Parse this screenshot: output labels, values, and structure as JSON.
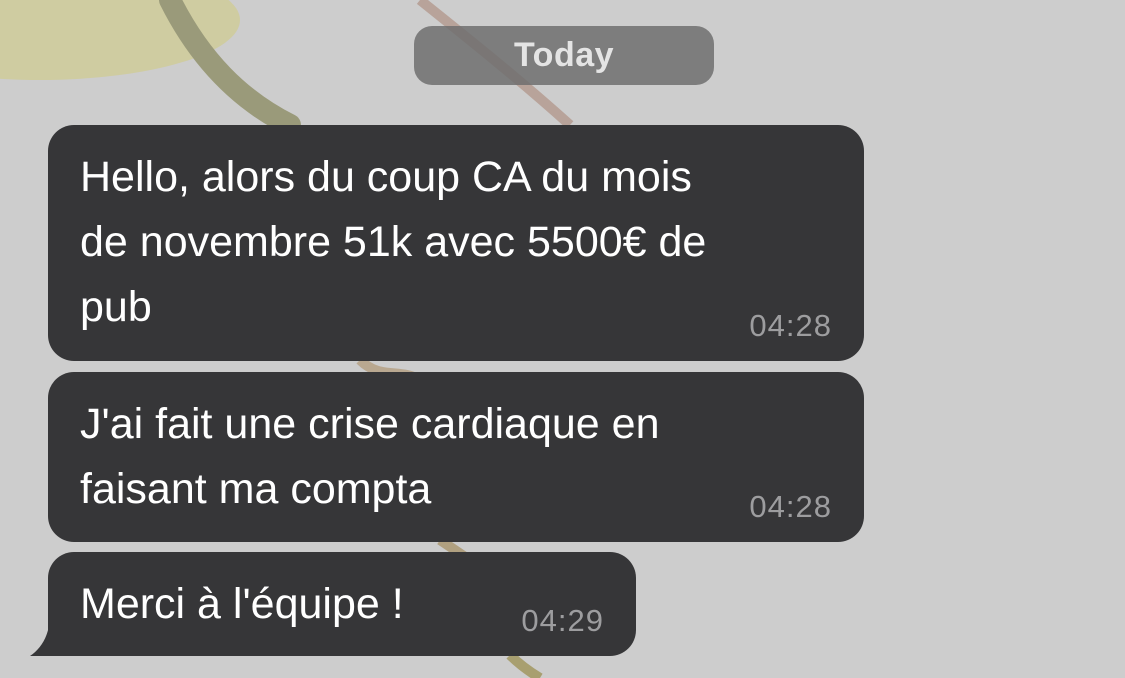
{
  "chat": {
    "date_separator": "Today",
    "messages": [
      {
        "text": "Hello, alors du coup CA du mois\nde novembre 51k avec 5500€ de\npub",
        "time": "04:28"
      },
      {
        "text": "J'ai fait une crise cardiaque en\nfaisant ma compta",
        "time": "04:28"
      },
      {
        "text": "Merci à l'équipe !",
        "time": "04:29"
      }
    ]
  },
  "colors": {
    "background": "#cdcdcd",
    "bubble": "#363638",
    "timestamp": "#9d9d9f",
    "date_pill": "#6e6e6e"
  }
}
